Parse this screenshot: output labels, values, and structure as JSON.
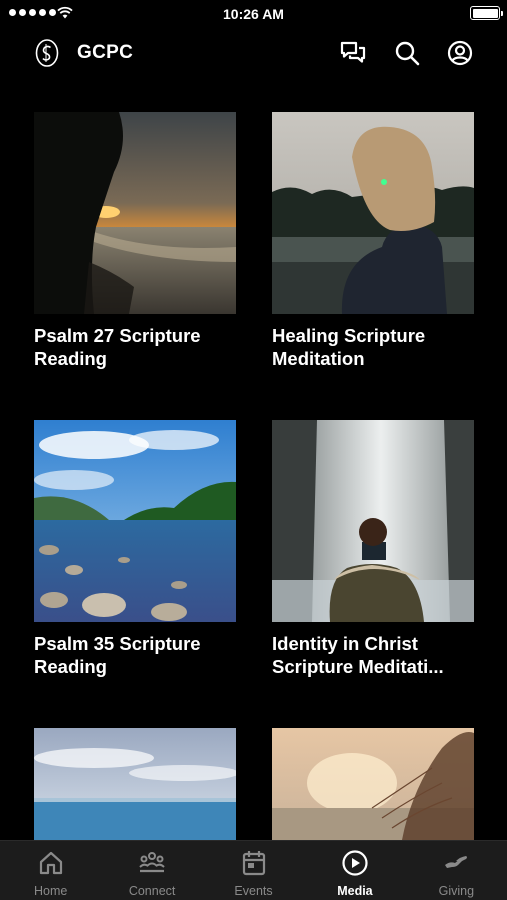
{
  "status_bar": {
    "time": "10:26 AM"
  },
  "header": {
    "title": "GCPC"
  },
  "media_items": [
    {
      "title_line1": "Psalm 27 Scripture",
      "title_line2": "Reading"
    },
    {
      "title_line1": "Healing Scripture",
      "title_line2": "Meditation"
    },
    {
      "title_line1": "Psalm 35 Scripture",
      "title_line2": "Reading"
    },
    {
      "title_line1": "Identity in Christ",
      "title_line2": "Scripture Meditati..."
    }
  ],
  "tabs": [
    {
      "label": "Home",
      "icon": "home-icon",
      "active": false
    },
    {
      "label": "Connect",
      "icon": "people-icon",
      "active": false
    },
    {
      "label": "Events",
      "icon": "calendar-icon",
      "active": false
    },
    {
      "label": "Media",
      "icon": "play-icon",
      "active": true
    },
    {
      "label": "Giving",
      "icon": "giving-icon",
      "active": false
    }
  ],
  "colors": {
    "background": "#000000",
    "tabbar": "#1c1c1c",
    "tab_inactive": "#8a8a8a",
    "tab_active": "#ffffff"
  }
}
